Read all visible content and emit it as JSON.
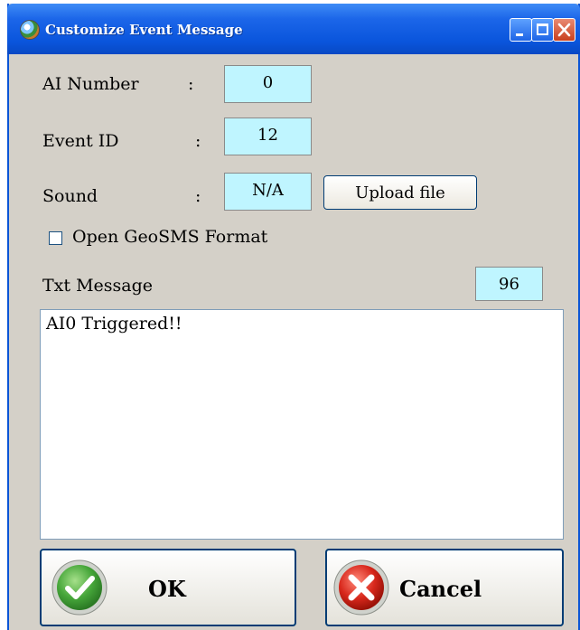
{
  "window": {
    "title": "Customize Event Message",
    "icon": "app-globe-icon"
  },
  "titlebar_buttons": [
    "minimize-icon",
    "maximize-icon",
    "close-icon"
  ],
  "fields": {
    "ai_number": {
      "label": "AI Number",
      "colon": ":",
      "value": "0"
    },
    "event_id": {
      "label": "Event ID",
      "colon": ":",
      "value": "12"
    },
    "sound": {
      "label": "Sound",
      "colon": ":",
      "value": "N/A",
      "upload_label": "Upload file"
    }
  },
  "geosms": {
    "label": "Open GeoSMS Format",
    "checked": false
  },
  "txt_message": {
    "label": "Txt Message",
    "remaining": "96",
    "value": "AI0 Triggered!!"
  },
  "buttons": {
    "ok": {
      "label": "OK",
      "icon": "check-icon"
    },
    "cancel": {
      "label": "Cancel",
      "icon": "x-icon"
    }
  },
  "colors": {
    "titlebar": "#0a55dc",
    "value_box": "#bff5ff",
    "dialog_bg": "#d4d0c8"
  }
}
